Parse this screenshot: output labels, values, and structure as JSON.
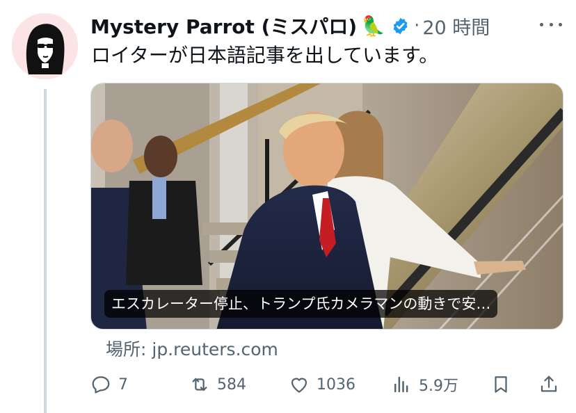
{
  "author": {
    "display_name": "Mystery Parrot (ミスパロ)",
    "emoji": "🦜",
    "verified": true,
    "separator": "·",
    "time_ago": "20 時間"
  },
  "tweet": {
    "text": "ロイターが日本語記事を出しています。"
  },
  "media": {
    "caption": "エスカレーター停止、トランプ氏カメラマンの動きで安…"
  },
  "source": {
    "label": "場所: jp.reuters.com"
  },
  "actions": {
    "replies": "7",
    "retweets": "584",
    "likes": "1036",
    "views": "5.9万"
  },
  "colors": {
    "text_primary": "#0f1419",
    "text_secondary": "#536471",
    "verified_blue": "#1d9bf0",
    "avatar_bg": "#fbe3e6",
    "thread_line": "#cfd9de"
  },
  "icons": {
    "more": "more-dots-icon",
    "reply": "reply-icon",
    "retweet": "retweet-icon",
    "like": "heart-icon",
    "views": "views-chart-icon",
    "bookmark": "bookmark-icon",
    "share": "share-icon",
    "verified": "verified-badge-icon"
  }
}
